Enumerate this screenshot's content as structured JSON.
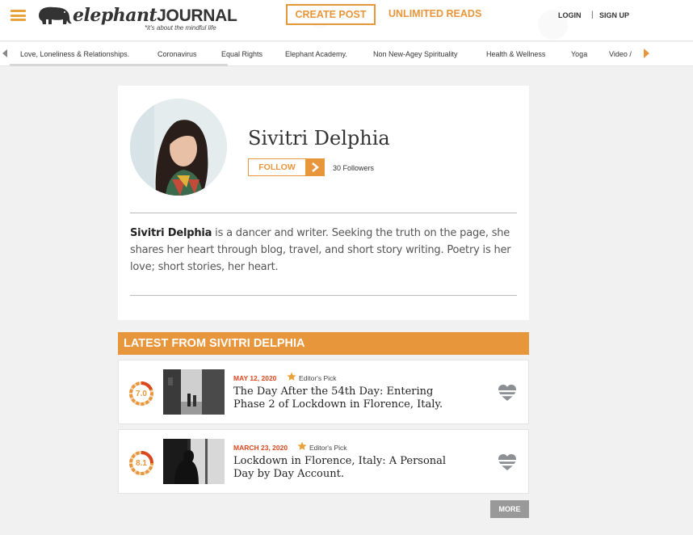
{
  "header": {
    "logo_text_elephant": "elephant",
    "logo_text_journal": "JOURNAL",
    "tagline": "*it's about the mindful life",
    "create_post": "CREATE POST",
    "unlimited_reads": "UNLIMITED READS",
    "login": "LOGIN",
    "separator": "|",
    "signup": "SIGN UP"
  },
  "categories": [
    "Love, Loneliness & Relationships.",
    "Coronavirus",
    "Equal Rights",
    "Elephant Academy.",
    "Non New-Agey Spirituality",
    "Health & Wellness",
    "Yoga",
    "Video /"
  ],
  "profile": {
    "name": "Sivitri Delphia",
    "follow_label": "FOLLOW",
    "followers": "30 Followers",
    "bio_name": "Sivitri Delphia",
    "bio_text": " is a dancer and writer. Seeking the truth on the page, she shares her heart through blog, travel, and short story writing. Poetry is her love; short stories, her heart."
  },
  "latest": {
    "heading": "LATEST FROM SIVITRI DELPHIA",
    "posts": [
      {
        "score": "7.0",
        "date": "MAY 12, 2020",
        "badge": "Editor's Pick",
        "title": "The Day After the 54th Day: Entering Phase 2 of Lockdown in Florence, Italy."
      },
      {
        "score": "8.1",
        "date": "MARCH 23, 2020",
        "badge": "Editor's Pick",
        "title": "Lockdown in Florence, Italy: A Personal Day by Day Account."
      }
    ],
    "more_label": "MORE"
  },
  "colors": {
    "accent": "#e8963b",
    "date_red": "#d9461f",
    "background": "#f1f1f1"
  }
}
